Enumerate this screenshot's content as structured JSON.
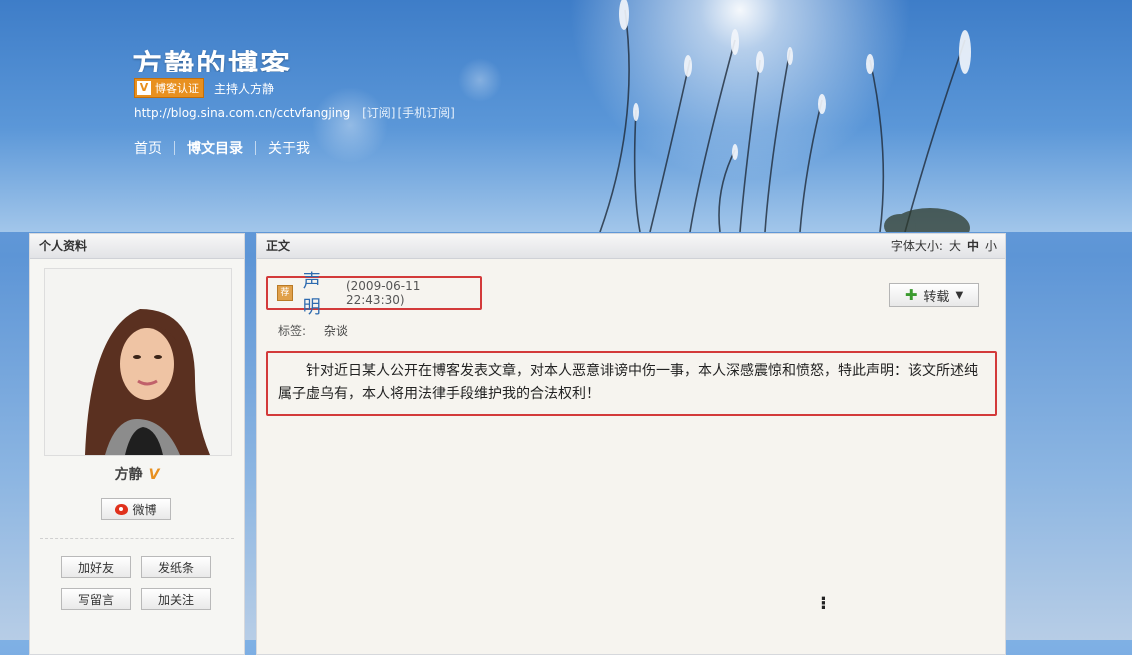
{
  "header": {
    "blog_title": "方静的博客",
    "cert_label": "博客认证",
    "host_label": "主持人方静",
    "blog_url": "http://blog.sina.com.cn/cctvfangjing",
    "subscribe_link": "[订阅]",
    "mobile_subscribe_link": "[手机订阅]",
    "nav": [
      {
        "label": "首页"
      },
      {
        "label": "博文目录"
      },
      {
        "label": "关于我"
      }
    ]
  },
  "sidebar": {
    "title": "个人资料",
    "name": "方静",
    "weibo_label": "微博",
    "actions": {
      "add_friend": "加好友",
      "send_note": "发纸条",
      "leave_message": "写留言",
      "follow": "加关注"
    }
  },
  "main": {
    "title": "正文",
    "font_size_label": "字体大小:",
    "font_sizes": [
      "大",
      "中",
      "小"
    ],
    "article": {
      "title": "声明",
      "timestamp": "(2009-06-11 22:43:30)",
      "tags_label": "标签:",
      "tag": "杂谈",
      "repost_label": "转载",
      "content": "针对近日某人公开在博客发表文章，对本人恶意诽谤中伤一事，本人深感震惊和愤怒，特此声明：该文所述纯属子虚乌有，本人将用法律手段维护我的合法权利！"
    }
  },
  "colors": {
    "accent_red_frame": "#d33a3a",
    "title_blue": "#2e6bb0",
    "cert_orange": "#e8901f"
  }
}
